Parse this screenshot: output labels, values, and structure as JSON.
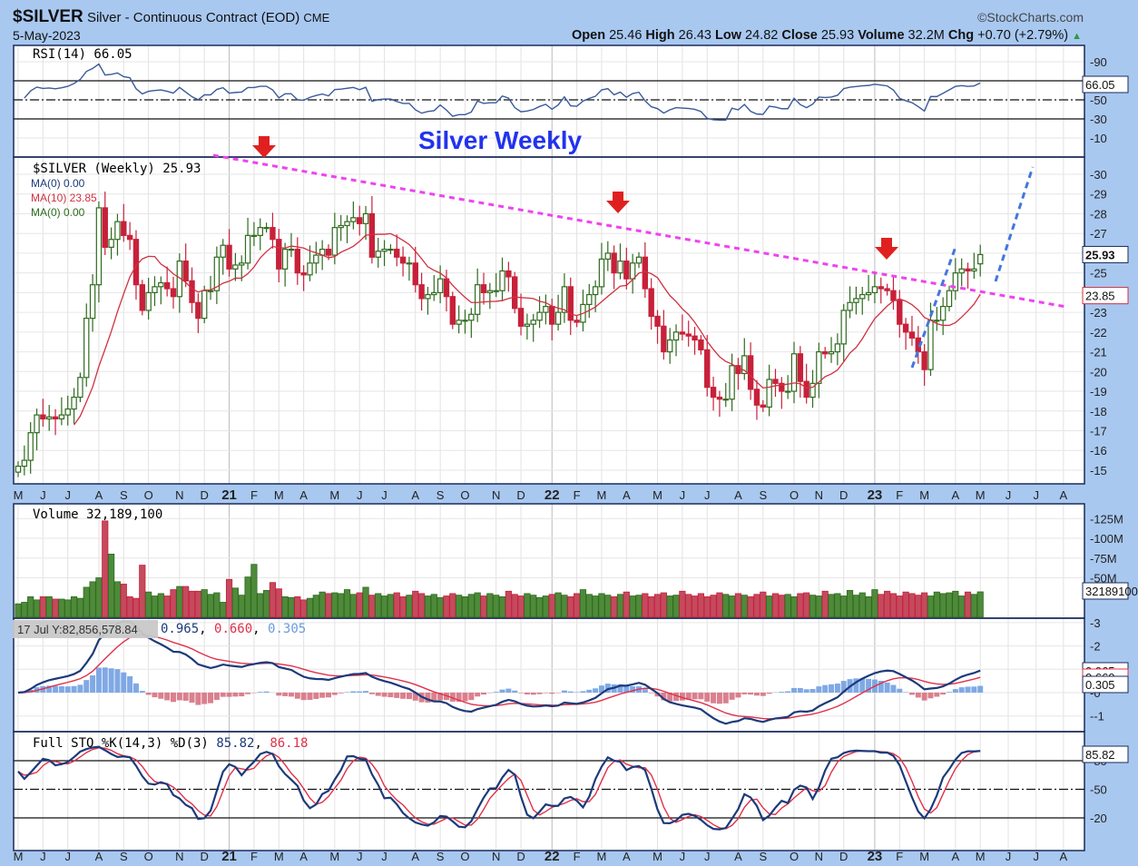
{
  "header": {
    "symbol": "$SILVER",
    "name": "Silver - Continuous Contract (EOD)",
    "exchange": "CME",
    "date": "5-May-2023",
    "watermark": "©StockCharts.com",
    "open_label": "Open",
    "open": "25.46",
    "high_label": "High",
    "high": "26.43",
    "low_label": "Low",
    "low": "24.82",
    "close_label": "Close",
    "close": "25.93",
    "volume_label": "Volume",
    "volume": "32.2M",
    "chg_label": "Chg",
    "chg": "+0.70 (+2.79%)"
  },
  "colors": {
    "background": "#a8c8f0",
    "up": "#2e6b1e",
    "down": "#c8203a",
    "ma10": "#d03040",
    "trendline": "#ee44ee",
    "channel": "#4477dd",
    "arrow": "#e02020",
    "title": "#2233ee",
    "macd": "#1c3a7a",
    "signal": "#e0304a",
    "histogram": "#6a9ae0"
  },
  "annotations": {
    "title": "Silver Weekly",
    "tooltip": "17 Jul Y:82,856,578.84"
  },
  "chart_data": [
    {
      "type": "line",
      "panel": "rsi",
      "legend": "RSI(14) 66.05",
      "last_value": "66.05",
      "ylim": [
        0,
        100
      ],
      "y_ticks": [
        "90",
        "70",
        "50",
        "30",
        "10"
      ],
      "levels": [
        70,
        50,
        30
      ]
    },
    {
      "type": "candlestick",
      "panel": "price",
      "legend": "$SILVER (Weekly) 25.93",
      "overlays": [
        {
          "name": "MA(0) 0.00",
          "color": "#1c3a7a"
        },
        {
          "name": "MA(10) 23.85",
          "color": "#d03040"
        },
        {
          "name": "MA(0) 0.00",
          "color": "#2e6b1e"
        }
      ],
      "last_close_label": "25.93",
      "last_ma_label": "23.85",
      "ylim": [
        14.5,
        30.5
      ],
      "y_ticks": [
        "30",
        "29",
        "28",
        "27",
        "26",
        "25",
        "24",
        "23",
        "22",
        "21",
        "20",
        "19",
        "18",
        "17",
        "16",
        "15"
      ],
      "x_ticks": [
        "M",
        "J",
        "J",
        "A",
        "S",
        "O",
        "N",
        "D",
        "21",
        "F",
        "M",
        "A",
        "M",
        "J",
        "J",
        "A",
        "S",
        "O",
        "N",
        "D",
        "22",
        "F",
        "M",
        "A",
        "M",
        "J",
        "J",
        "A",
        "S",
        "O",
        "N",
        "D",
        "23",
        "F",
        "M",
        "A",
        "M",
        "J",
        "J",
        "A"
      ],
      "last_bar": {
        "open": 25.46,
        "high": 26.43,
        "low": 24.82,
        "close": 25.93
      },
      "closes": [
        15.2,
        15.5,
        16.9,
        17.8,
        17.6,
        17.7,
        17.6,
        17.8,
        18.1,
        18.7,
        19.7,
        22.7,
        24.4,
        28.3,
        26.3,
        26.7,
        27.6,
        26.9,
        26.7,
        24.4,
        23.1,
        24.0,
        24.3,
        24.5,
        24.2,
        23.8,
        25.6,
        24.6,
        23.5,
        22.7,
        24.1,
        24.1,
        25.8,
        26.4,
        25.2,
        25.4,
        25.5,
        26.9,
        26.9,
        27.3,
        27.3,
        26.7,
        25.2,
        26.2,
        26.2,
        25.0,
        24.9,
        25.5,
        25.9,
        26.2,
        25.9,
        27.3,
        27.4,
        27.6,
        27.8,
        27.5,
        28.0,
        25.8,
        26.1,
        26.2,
        26.2,
        25.8,
        25.5,
        25.5,
        24.4,
        23.7,
        23.9,
        24.0,
        24.7,
        23.8,
        22.4,
        22.6,
        22.6,
        22.9,
        24.4,
        24.0,
        24.1,
        24.1,
        25.1,
        24.8,
        23.2,
        22.3,
        22.4,
        22.6,
        23.0,
        23.3,
        22.4,
        23.0,
        24.3,
        22.6,
        22.5,
        23.4,
        23.9,
        24.3,
        25.7,
        26.0,
        25.0,
        25.6,
        24.7,
        25.5,
        25.8,
        24.2,
        22.8,
        22.3,
        21.0,
        21.6,
        22.0,
        21.9,
        21.8,
        21.6,
        21.1,
        19.2,
        18.7,
        18.6,
        18.6,
        20.3,
        19.9,
        20.8,
        19.1,
        18.3,
        18.2,
        19.6,
        19.4,
        19.0,
        19.0,
        20.9,
        19.5,
        18.7,
        19.4,
        21.0,
        20.9,
        21.0,
        21.4,
        23.1,
        23.5,
        23.7,
        23.9,
        24.0,
        24.3,
        24.2,
        24.1,
        23.6,
        22.4,
        22.0,
        21.7,
        21.0,
        20.1,
        22.6,
        22.6,
        23.3,
        24.1,
        25.0,
        25.2,
        25.1,
        25.2,
        25.93
      ]
    },
    {
      "type": "bar",
      "panel": "volume",
      "legend": "Volume 32,189,100",
      "last_value_label": "32189100",
      "y_ticks": [
        "125M",
        "100M",
        "75M",
        "50M"
      ],
      "unit": "millions",
      "values": [
        17,
        19,
        26,
        22,
        26,
        26,
        23,
        23,
        22,
        26,
        24,
        38,
        45,
        50,
        122,
        80,
        45,
        42,
        26,
        24,
        66,
        32,
        27,
        30,
        27,
        35,
        39,
        39,
        33,
        33,
        35,
        29,
        31,
        19,
        48,
        37,
        28,
        51,
        67,
        30,
        34,
        44,
        36,
        26,
        25,
        26,
        22,
        24,
        28,
        32,
        30,
        31,
        30,
        35,
        29,
        31,
        38,
        28,
        30,
        27,
        29,
        31,
        26,
        28,
        33,
        30,
        27,
        29,
        25,
        27,
        30,
        28,
        26,
        29,
        31,
        27,
        30,
        28,
        26,
        33,
        29,
        27,
        30,
        28,
        25,
        27,
        29,
        31,
        28,
        26,
        30,
        35,
        29,
        27,
        30,
        28,
        26,
        29,
        32,
        27,
        28,
        30,
        26,
        29,
        31,
        27,
        28,
        33,
        29,
        27,
        30,
        26,
        28,
        31,
        29,
        27,
        30,
        28,
        26,
        29,
        32,
        27,
        30,
        28,
        29,
        26,
        30,
        31,
        28,
        27,
        33,
        29,
        30,
        27,
        34,
        28,
        31,
        26,
        35,
        29,
        33,
        30,
        27,
        32,
        30,
        28,
        31,
        27,
        32,
        30,
        31,
        33,
        27,
        32,
        29,
        32.2
      ]
    },
    {
      "type": "line",
      "panel": "macd",
      "legend_values": [
        "0.965",
        "0.660",
        "0.305"
      ],
      "value_labels": [
        "0.965",
        "0.660",
        "0.305"
      ],
      "y_ticks": [
        "3",
        "2",
        "1",
        "0",
        "-1"
      ]
    },
    {
      "type": "line",
      "panel": "stochastic",
      "legend": "Full STO %K(14,3) %D(3)",
      "k_value": "85.82",
      "d_value": "86.18",
      "last_value_label": "85.82",
      "y_ticks": [
        "80",
        "50",
        "20"
      ],
      "levels": [
        80,
        50,
        20
      ]
    }
  ]
}
